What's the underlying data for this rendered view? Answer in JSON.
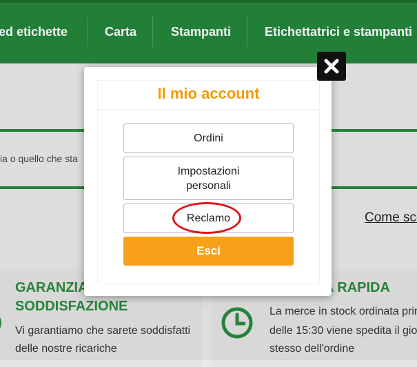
{
  "nav": {
    "items": [
      "ed etichette",
      "Carta",
      "Stampanti",
      "Etichettatrici e stampanti"
    ]
  },
  "search": {
    "visible_text": "ia o quello che sta"
  },
  "howto": {
    "label": "Come sce"
  },
  "features": [
    {
      "title_1": "GARANZIA",
      "title_2": "SODDISFAZIONE",
      "text_1": "Vi garantiamo che sarete soddisfatti",
      "text_2": "delle nostre ricariche"
    },
    {
      "title_1": "A RAPIDA",
      "text_1": "La merce in stock ordinata prim",
      "text_2": "delle 15:30 viene spedita il gior",
      "text_3": "stesso dell'ordine"
    }
  ],
  "modal": {
    "title": "Il mio account",
    "buttons": {
      "orders": "Ordini",
      "settings_1": "Impostazioni",
      "settings_2": "personali",
      "complaint": "Reclamo",
      "exit": "Esci"
    }
  },
  "colors": {
    "brand_green": "#24863b",
    "accent_orange": "#f7a11a",
    "title_orange": "#f39a0c",
    "highlight_red": "#e0151c"
  },
  "icons": {
    "close": "close-icon",
    "clock": "clock-icon"
  }
}
